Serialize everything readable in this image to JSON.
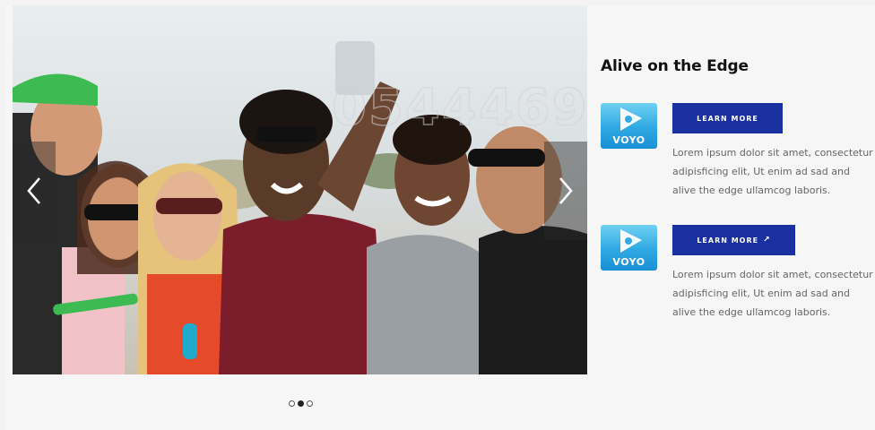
{
  "carousel": {
    "watermark": "0544469",
    "prev_icon": "chevron-left-icon",
    "next_icon": "chevron-right-icon",
    "slide_count": 3,
    "active_slide": 2
  },
  "panel": {
    "title": "Alive on the Edge",
    "cards": [
      {
        "logo_text": "VOYO",
        "button_label": "LEARN MORE",
        "external_icon": "",
        "description": "Lorem ipsum dolor sit amet, consectetur adipisficing elit, Ut enim ad sad and alive the edge ullamcog laboris."
      },
      {
        "logo_text": "VOYO",
        "button_label": "LEARN MORE",
        "external_icon": "↗",
        "description": "Lorem ipsum dolor sit amet, consectetur adipisficing elit, Ut enim ad sad and alive the edge ullamcog laboris."
      }
    ]
  },
  "colors": {
    "button_bg": "#1a2fa0",
    "logo_blue": "#2fa8e3",
    "title": "#111111",
    "body_text": "#666666"
  }
}
